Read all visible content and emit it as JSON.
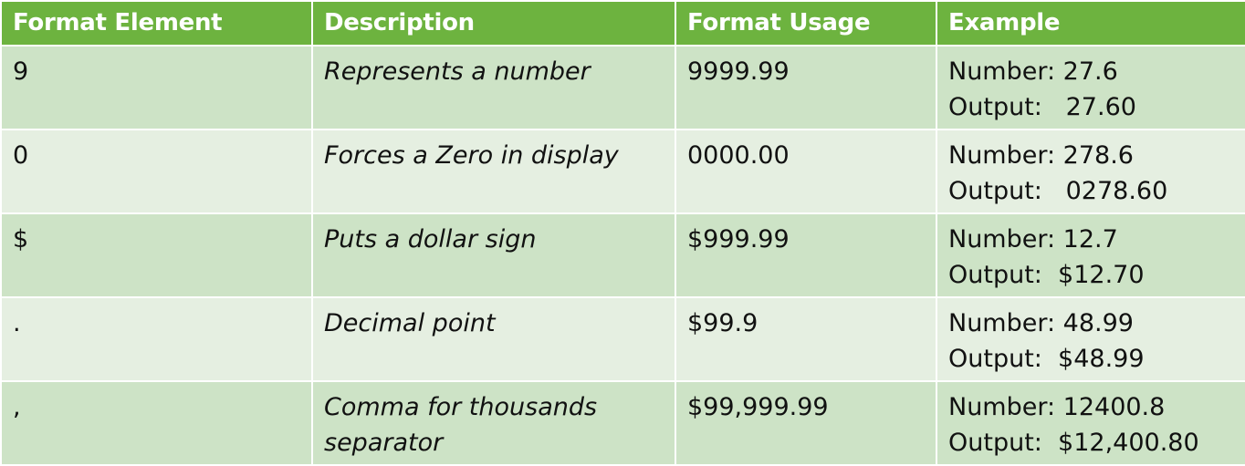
{
  "table": {
    "headers": [
      "Format Element",
      "Description",
      "Format Usage",
      "Example"
    ],
    "rows": [
      {
        "element": "9",
        "description": "Represents a number",
        "usage": "9999.99",
        "example_number": "Number: 27.6",
        "example_output": "Output:   27.60"
      },
      {
        "element": "0",
        "description": "Forces a Zero in display",
        "usage": "0000.00",
        "example_number": "Number: 278.6",
        "example_output": "Output:   0278.60"
      },
      {
        "element": "$",
        "description": "Puts a dollar sign",
        "usage": "$999.99",
        "example_number": "Number: 12.7",
        "example_output": "Output:  $12.70"
      },
      {
        "element": ".",
        "description": "Decimal point",
        "usage": "$99.9",
        "example_number": "Number: 48.99",
        "example_output": "Output:  $48.99"
      },
      {
        "element": ",",
        "description": "Comma for thousands separator",
        "usage": "$99,999.99",
        "example_number": "Number: 12400.8",
        "example_output": "Output:  $12,400.80"
      }
    ]
  }
}
